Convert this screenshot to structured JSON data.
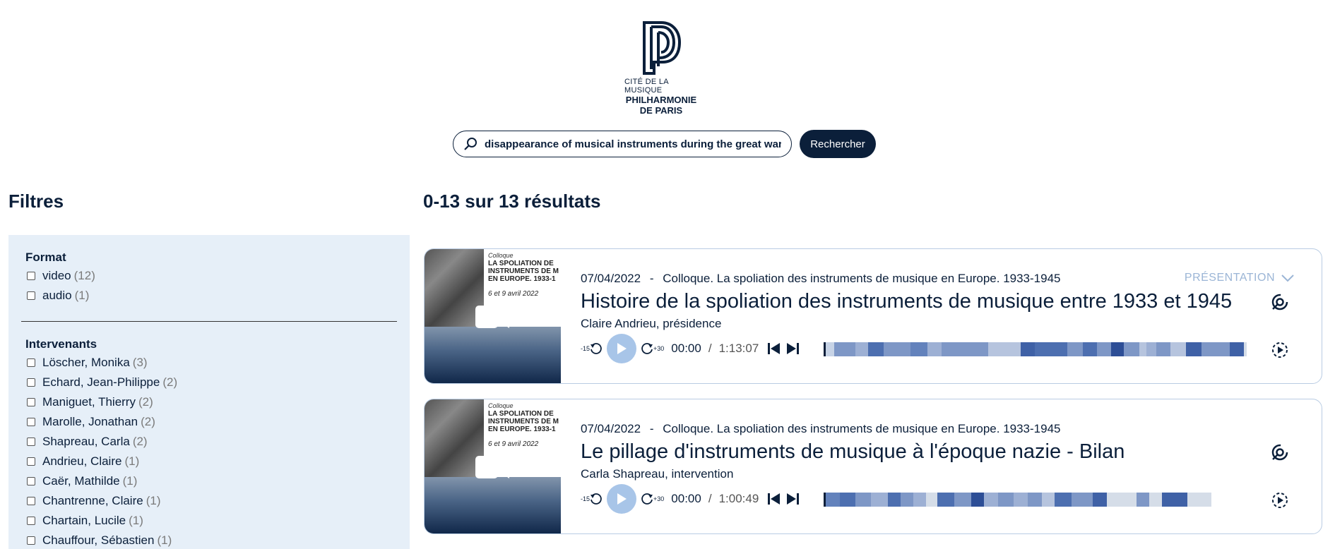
{
  "header": {
    "logo_small": "CITÉ DE LA MUSIQUE",
    "logo_line1": "PHILHARMONIE",
    "logo_line2": "DE PARIS",
    "search_value": "disappearance of musical instruments during the great war",
    "search_button": "Rechercher"
  },
  "filters": {
    "title": "Filtres",
    "format": {
      "title": "Format",
      "items": [
        {
          "label": "video",
          "count": "(12)"
        },
        {
          "label": "audio",
          "count": "(1)"
        }
      ]
    },
    "intervenants": {
      "title": "Intervenants",
      "items": [
        {
          "label": "Löscher, Monika",
          "count": "(3)"
        },
        {
          "label": "Echard, Jean-Philippe",
          "count": "(2)"
        },
        {
          "label": "Maniguet, Thierry",
          "count": "(2)"
        },
        {
          "label": "Marolle, Jonathan",
          "count": "(2)"
        },
        {
          "label": "Shapreau, Carla",
          "count": "(2)"
        },
        {
          "label": "Andrieu, Claire",
          "count": "(1)"
        },
        {
          "label": "Caër, Mathilde",
          "count": "(1)"
        },
        {
          "label": "Chantrenne, Claire",
          "count": "(1)"
        },
        {
          "label": "Chartain, Lucile",
          "count": "(1)"
        },
        {
          "label": "Chauffour, Sébastien",
          "count": "(1)"
        }
      ]
    }
  },
  "results": {
    "title": "0-13 sur 13 résultats",
    "items": [
      {
        "date": "07/04/2022",
        "separator": "-",
        "event": "Colloque. La spoliation des instruments de musique en Europe. 1933-1945",
        "title": "Histoire de la spoliation des instruments de musique entre 1933 et 1945",
        "speaker": "Claire Andrieu, présidence",
        "presentation": "PRÉSENTATION",
        "time_current": "00:00",
        "time_sep": "/",
        "time_total": "1:13:07",
        "skip_back": "-15",
        "skip_fwd": "+30",
        "poster": {
          "line1": "Colloque",
          "line2": "LA SPOLIATION DE",
          "line3": "INSTRUMENTS DE M",
          "line4": "EN EUROPE. 1933-1",
          "line5": "6 et 9 avril 2022"
        }
      },
      {
        "date": "07/04/2022",
        "separator": "-",
        "event": "Colloque. La spoliation des instruments de musique en Europe. 1933-1945",
        "title": "Le pillage d'instruments de musique à l'époque nazie - Bilan",
        "speaker": "Carla Shapreau, intervention",
        "time_current": "00:00",
        "time_sep": "/",
        "time_total": "1:00:49",
        "skip_back": "-15",
        "skip_fwd": "+30",
        "poster": {
          "line1": "Colloque",
          "line2": "LA SPOLIATION DE",
          "line3": "INSTRUMENTS DE M",
          "line4": "EN EUROPE. 1933-1",
          "line5": "6 et 9 avril 2022"
        }
      }
    ]
  },
  "colors": {
    "navy": "#0b1f3a",
    "panel": "#e6eff8",
    "accent_light": "#a8c5e8",
    "presentation_text": "#9bb5d6"
  }
}
